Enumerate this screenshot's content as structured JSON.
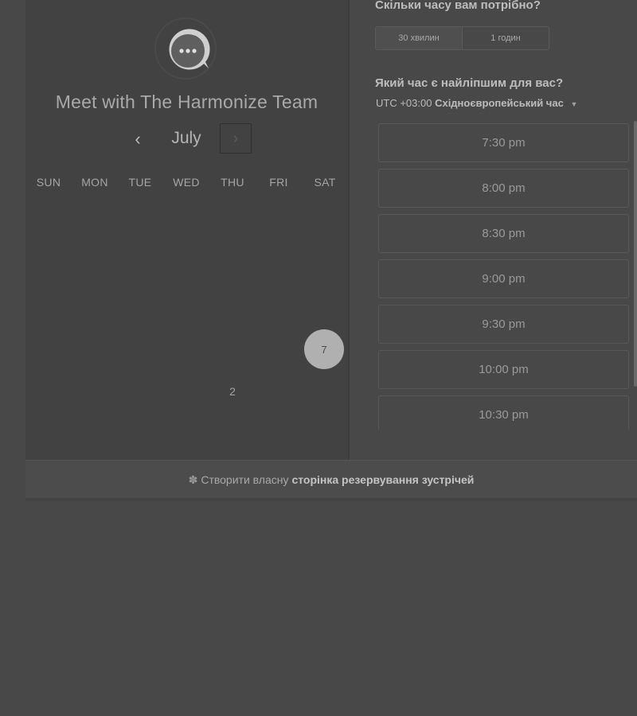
{
  "calendar": {
    "title": "Meet with The Harmonize Team",
    "month": "July",
    "prev_icon": "‹",
    "next_icon": "›",
    "weekdays": [
      "SUN",
      "MON",
      "TUE",
      "WED",
      "THU",
      "FRI",
      "SAT"
    ],
    "selected_day": "7",
    "other_day": "2"
  },
  "duration": {
    "title": "Скільки часу вам потрібно?",
    "options": [
      "30 хвилин",
      "1 годин"
    ],
    "selected": "30 хвилин"
  },
  "time": {
    "title": "Який час є найліпшим для вас?",
    "tz_offset": "UTC +03:00",
    "tz_name": "Східноєвропейський час",
    "slots": [
      "7:30 pm",
      "8:00 pm",
      "8:30 pm",
      "9:00 pm",
      "9:30 pm",
      "10:00 pm",
      "10:30 pm"
    ]
  },
  "footer": {
    "prefix": "Створити власну",
    "link": "сторінка резервування зустрічей"
  }
}
